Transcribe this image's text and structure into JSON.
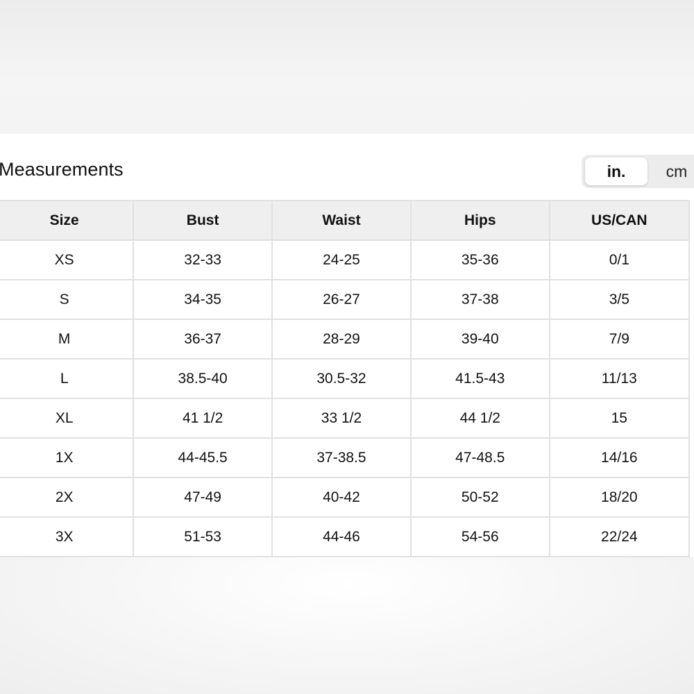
{
  "title": "Measurements",
  "unit_toggle": {
    "active": "in.",
    "inactive": "cm"
  },
  "table": {
    "headers": [
      "Size",
      "Bust",
      "Waist",
      "Hips",
      "US/CAN"
    ],
    "rows": [
      [
        "XS",
        "32-33",
        "24-25",
        "35-36",
        "0/1"
      ],
      [
        "S",
        "34-35",
        "26-27",
        "37-38",
        "3/5"
      ],
      [
        "M",
        "36-37",
        "28-29",
        "39-40",
        "7/9"
      ],
      [
        "L",
        "38.5-40",
        "30.5-32",
        "41.5-43",
        "11/13"
      ],
      [
        "XL",
        "41 1/2",
        "33 1/2",
        "44 1/2",
        "15"
      ],
      [
        "1X",
        "44-45.5",
        "37-38.5",
        "47-48.5",
        "14/16"
      ],
      [
        "2X",
        "47-49",
        "40-42",
        "50-52",
        "18/20"
      ],
      [
        "3X",
        "51-53",
        "44-46",
        "54-56",
        "22/24"
      ]
    ]
  }
}
